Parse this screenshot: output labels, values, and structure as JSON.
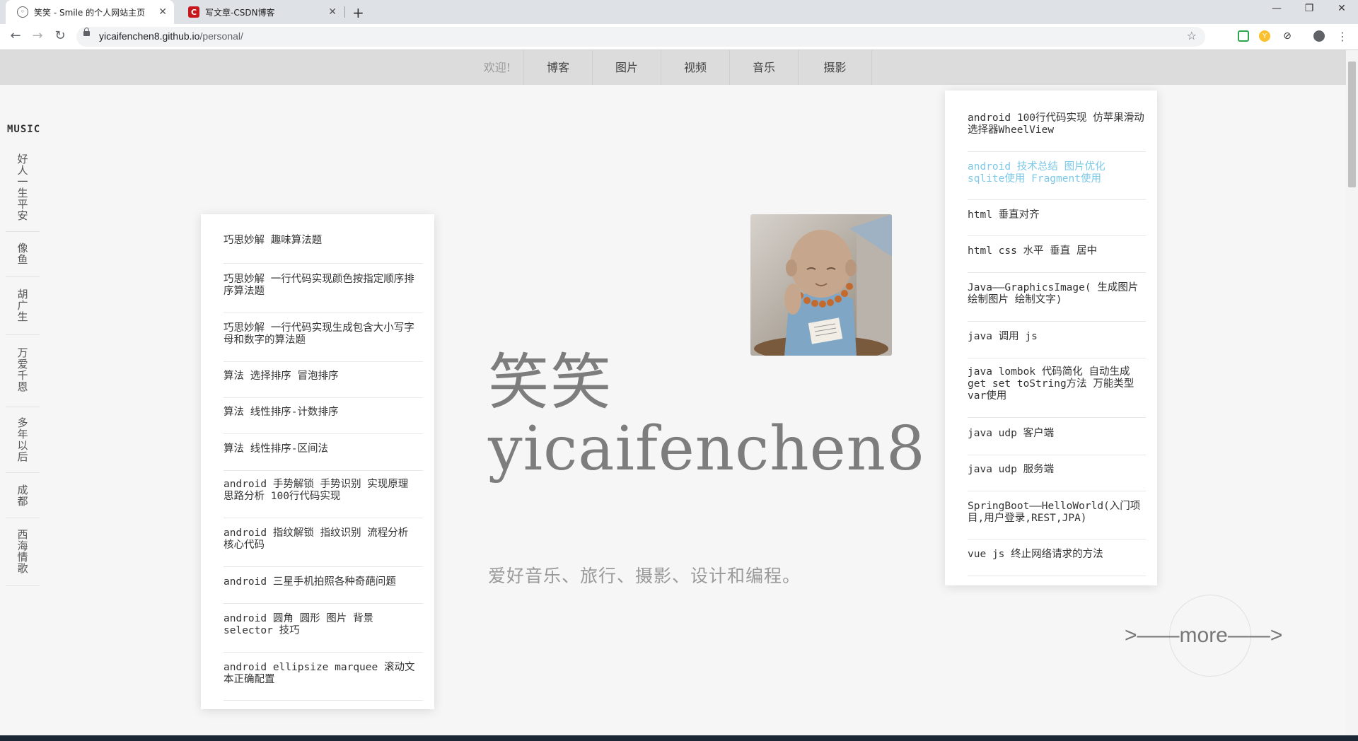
{
  "browser": {
    "tabs": [
      {
        "title": "笑笑 - Smile 的个人网站主页",
        "favicon": "globe-icon"
      },
      {
        "title": "写文章-CSDN博客",
        "favicon": "csdn-icon"
      }
    ],
    "url_host": "yicaifenchen8.github.io",
    "url_path": "/personal/"
  },
  "nav": {
    "items": [
      "欢迎!",
      "博客",
      "图片",
      "视频",
      "音乐",
      "摄影"
    ]
  },
  "music": {
    "title": "MUSIC",
    "songs": [
      "好人一生平安",
      "像鱼",
      "胡广生",
      "万爱千恩",
      "多年以后",
      "成都",
      "西海情歌"
    ]
  },
  "left_list": [
    "巧思妙解 趣味算法题",
    "巧思妙解 一行代码实现颜色按指定顺序排序算法题",
    "巧思妙解 一行代码实现生成包含大小写字母和数字的算法题",
    "算法 选择排序 冒泡排序",
    "算法 线性排序-计数排序",
    "算法 线性排序-区间法",
    "android 手势解锁 手势识别 实现原理 思路分析 100行代码实现",
    "android 指纹解锁 指纹识别 流程分析 核心代码",
    "android 三星手机拍照各种奇葩问题",
    "android 圆角 圆形 图片 背景 selector 技巧",
    "android ellipsize marquee 滚动文本正确配置"
  ],
  "right_list": [
    "android 100行代码实现 仿苹果滑动选择器WheelView",
    "android 技术总结 图片优化 sqlite使用 Fragment使用",
    "html 垂直对齐",
    "html css 水平 垂直 居中",
    "Java——GraphicsImage( 生成图片 绘制图片 绘制文字)",
    "java 调用 js",
    "java lombok 代码简化 自动生成get set toString方法 万能类型var使用",
    "java udp 客户端",
    "java udp 服务端",
    "SpringBoot——HelloWorld(入门项目,用户登录,REST,JPA)",
    "vue js 终止网络请求的方法"
  ],
  "hero": {
    "name_cn": "笑笑",
    "name_en": "yicaifenchen8",
    "tagline": "爱好音乐、旅行、摄影、设计和编程。",
    "more": ">——more——>"
  },
  "colors": {
    "highlight_link": "#7ec9e8",
    "nav_bg": "#dcdcdc",
    "page_bg": "#f6f6f6"
  }
}
